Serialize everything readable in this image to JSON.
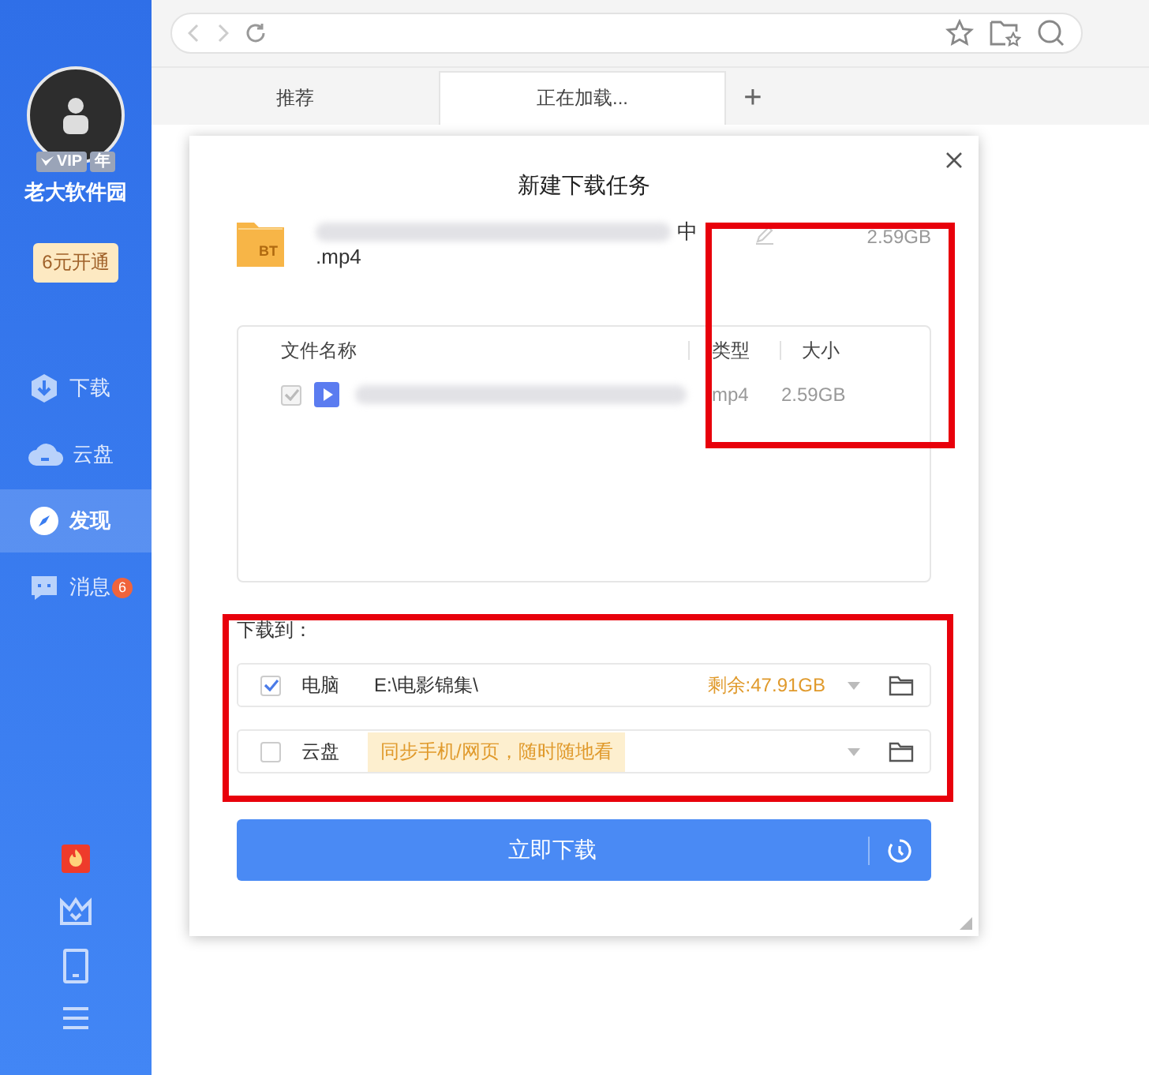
{
  "sidebar": {
    "vip_label": "VIP",
    "vip_term": "年",
    "user_name": "老大软件园",
    "promo": "6元开通",
    "nav": [
      {
        "label": "下载",
        "selected": false
      },
      {
        "label": "云盘",
        "selected": false
      },
      {
        "label": "发现",
        "selected": true
      },
      {
        "label": "消息",
        "selected": false,
        "badge": "6"
      }
    ]
  },
  "browser": {
    "tabs": [
      {
        "label": "推荐",
        "selected": false
      },
      {
        "label": "正在加载...",
        "selected": true
      }
    ],
    "new_tab": "+"
  },
  "dialog": {
    "title": "新建下载任务",
    "file": {
      "badge": "BT",
      "name_fragment": "中",
      "name_tail": ".mp4",
      "size": "2.59GB"
    },
    "columns": [
      "文件名称",
      "类型",
      "大小"
    ],
    "files": [
      {
        "checked": true,
        "disabled": true,
        "type": "mp4",
        "size": "2.59GB"
      }
    ],
    "destination_label": "下载到：",
    "destinations": [
      {
        "kind": "local",
        "checked": true,
        "label": "电脑",
        "path": "E:\\电影锦集\\",
        "free": "剩余:47.91GB"
      },
      {
        "kind": "cloud",
        "checked": false,
        "label": "云盘",
        "hint": "同步手机/网页，随时随地看"
      }
    ],
    "download_button": "立即下载",
    "highlight_boxes": [
      {
        "kind": "highlight"
      },
      {
        "kind": "highlight"
      }
    ]
  }
}
